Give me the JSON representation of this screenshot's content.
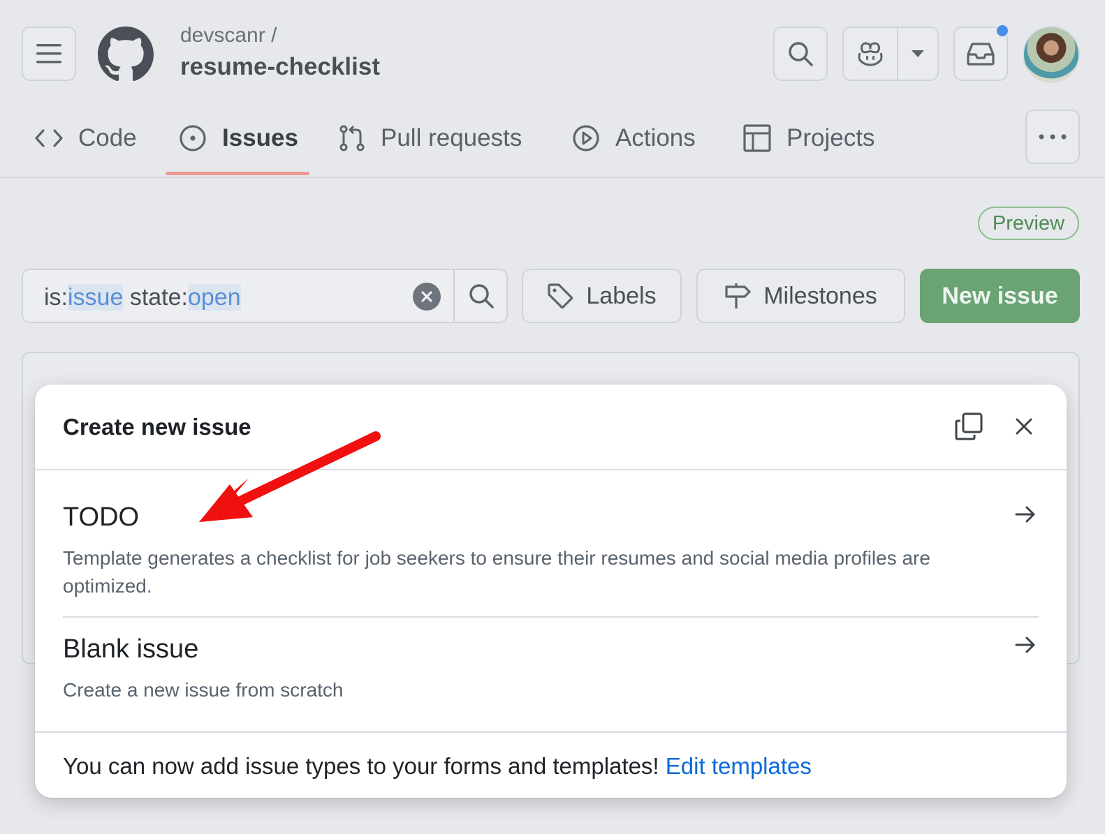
{
  "header": {
    "owner": "devscanr /",
    "repo": "resume-checklist",
    "icons": [
      "menu-icon",
      "github-logo",
      "search-icon",
      "copilot-icon",
      "triangle-down-icon",
      "inbox-icon"
    ],
    "notification_dot_color": "#4a8ee8"
  },
  "tabs": [
    {
      "label": "Code",
      "icon": "code-icon"
    },
    {
      "label": "Issues",
      "icon": "issue-opened-icon",
      "active": true
    },
    {
      "label": "Pull requests",
      "icon": "git-pull-request-icon"
    },
    {
      "label": "Actions",
      "icon": "play-icon"
    },
    {
      "label": "Projects",
      "icon": "table-icon"
    }
  ],
  "preview_badge": "Preview",
  "search": {
    "prefix1": "is:",
    "token1": "issue",
    "prefix2": " state:",
    "token2": "open"
  },
  "toolbar": {
    "labels": "Labels",
    "milestones": "Milestones",
    "new_issue": "New issue",
    "new_issue_color": "#6aa374"
  },
  "dialog": {
    "title": "Create new issue",
    "templates": [
      {
        "title": "TODO",
        "description": "Template generates a checklist for job seekers to ensure their resumes and social media profiles are optimized."
      },
      {
        "title": "Blank issue",
        "description": "Create a new issue from scratch"
      }
    ],
    "footer_text": "You can now add issue types to your forms and templates! ",
    "footer_link": "Edit templates"
  },
  "annotation_arrow_color": "#f01010"
}
